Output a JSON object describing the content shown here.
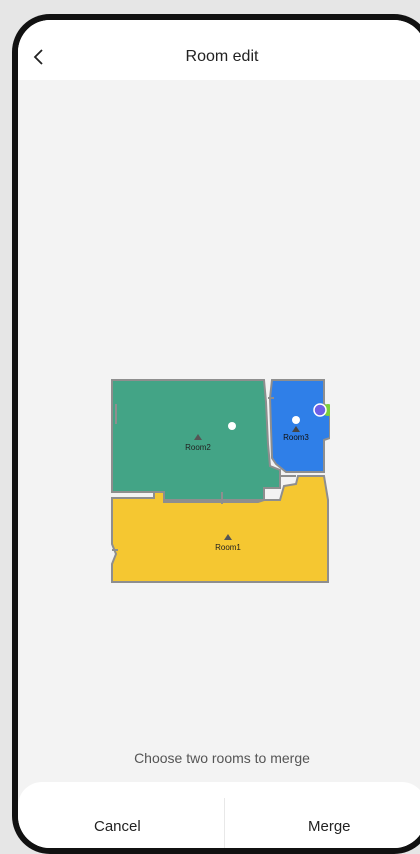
{
  "header": {
    "title": "Room edit",
    "back_icon": "chevron-left-icon"
  },
  "map": {
    "rooms": [
      {
        "label": "Room2",
        "color": "#43a486"
      },
      {
        "label": "Room3",
        "color": "#2f7fe8"
      },
      {
        "label": "Room1",
        "color": "#f5c731"
      }
    ],
    "wall_color": "#8e8e8e",
    "dock_icon": "charging-dock-icon",
    "robot_icon": "robot-icon"
  },
  "hint": "Choose two rooms to merge",
  "footer": {
    "cancel_label": "Cancel",
    "merge_label": "Merge"
  }
}
